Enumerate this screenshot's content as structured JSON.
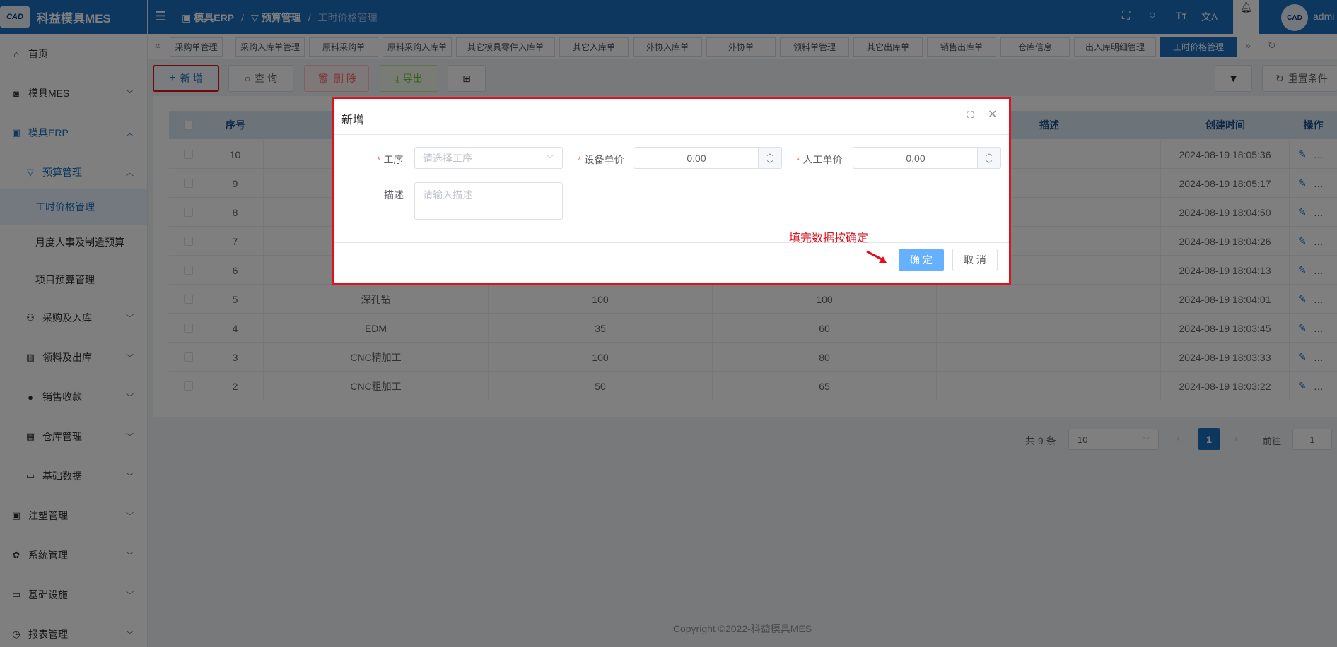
{
  "app": {
    "logo_text": "CAD",
    "title": "科益模具MES"
  },
  "sidebar": {
    "items": [
      {
        "label": "首页",
        "icon": "home-icon"
      },
      {
        "label": "模具MES",
        "icon": "camera-icon"
      },
      {
        "label": "模具ERP",
        "icon": "briefcase-icon"
      },
      {
        "label": "预算管理",
        "icon": "filter-icon"
      },
      {
        "label": "工时价格管理"
      },
      {
        "label": "月度人事及制造预算"
      },
      {
        "label": "项目预算管理"
      },
      {
        "label": "采购及入库",
        "icon": "bike-icon"
      },
      {
        "label": "领料及出库",
        "icon": "building-icon"
      },
      {
        "label": "销售收款",
        "icon": "user-icon"
      },
      {
        "label": "仓库管理",
        "icon": "calendar-icon"
      },
      {
        "label": "基础数据",
        "icon": "card-icon"
      },
      {
        "label": "注塑管理",
        "icon": "briefcase-icon"
      },
      {
        "label": "系统管理",
        "icon": "gear-icon"
      },
      {
        "label": "基础设施",
        "icon": "monitor-icon"
      },
      {
        "label": "报表管理",
        "icon": "clock-icon"
      }
    ]
  },
  "breadcrumb": {
    "items": [
      "模具ERP",
      "预算管理",
      "工时价格管理"
    ]
  },
  "header": {
    "user": "admi"
  },
  "tags": [
    "采购单管理",
    "采购入库单管理",
    "原料采购单",
    "原料采购入库单",
    "其它模具零件入库单",
    "其它入库单",
    "外协入库单",
    "外协单",
    "领料单管理",
    "其它出库单",
    "销售出库单",
    "仓库信息",
    "出入库明细管理",
    "工时价格管理"
  ],
  "toolbar": {
    "add": "新 增",
    "search": "查 询",
    "delete": "删 除",
    "export": "导出",
    "reset": "重置条件"
  },
  "table": {
    "headers": {
      "index": "序号",
      "desc": "描述",
      "created": "创建时间",
      "ops": "操作"
    },
    "rows": [
      {
        "no": "10",
        "process": "",
        "equip": "",
        "labor": "",
        "created": "2024-08-19 18:05:36"
      },
      {
        "no": "9",
        "process": "",
        "equip": "",
        "labor": "",
        "created": "2024-08-19 18:05:17"
      },
      {
        "no": "8",
        "process": "",
        "equip": "",
        "labor": "",
        "created": "2024-08-19 18:04:50"
      },
      {
        "no": "7",
        "process": "",
        "equip": "",
        "labor": "",
        "created": "2024-08-19 18:04:26"
      },
      {
        "no": "6",
        "process": "",
        "equip": "",
        "labor": "",
        "created": "2024-08-19 18:04:13"
      },
      {
        "no": "5",
        "process": "深孔钻",
        "equip": "100",
        "labor": "100",
        "created": "2024-08-19 18:04:01"
      },
      {
        "no": "4",
        "process": "EDM",
        "equip": "35",
        "labor": "60",
        "created": "2024-08-19 18:03:45"
      },
      {
        "no": "3",
        "process": "CNC精加工",
        "equip": "100",
        "labor": "80",
        "created": "2024-08-19 18:03:33"
      },
      {
        "no": "2",
        "process": "CNC粗加工",
        "equip": "50",
        "labor": "65",
        "created": "2024-08-19 18:03:22"
      }
    ]
  },
  "pagination": {
    "total": "共 9 条",
    "page_size": "10",
    "current": "1",
    "goto_label": "前往",
    "goto_value": "1"
  },
  "dialog": {
    "title": "新增",
    "process_label": "工序",
    "process_placeholder": "请选择工序",
    "equip_label": "设备单价",
    "equip_value": "0.00",
    "labor_label": "人工单价",
    "labor_value": "0.00",
    "desc_label": "描述",
    "desc_placeholder": "请输入描述",
    "annotation": "填完数据按确定",
    "confirm": "确 定",
    "cancel": "取 消"
  },
  "footer": {
    "copyright": "Copyright ©2022-科益模具MES"
  },
  "colors": {
    "primary": "#1a6fbf",
    "annotation_red": "#e0101f",
    "confirm_blue": "#66b1ff"
  }
}
